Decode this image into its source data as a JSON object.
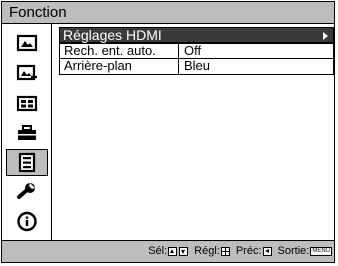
{
  "menu": {
    "title": "Fonction",
    "icons": [
      {
        "name": "picture-icon",
        "active": false
      },
      {
        "name": "advanced-picture-icon",
        "active": false
      },
      {
        "name": "screen-icon",
        "active": false
      },
      {
        "name": "setup-icon",
        "active": false
      },
      {
        "name": "function-icon",
        "active": true
      },
      {
        "name": "installation-icon",
        "active": false
      },
      {
        "name": "information-icon",
        "active": false
      }
    ],
    "rows": [
      {
        "label": "Réglages HDMI",
        "value": "",
        "selected": true
      },
      {
        "label": "Rech. ent. auto.",
        "value": "Off",
        "selected": false
      },
      {
        "label": "Arrière-plan",
        "value": "Bleu",
        "selected": false
      }
    ]
  },
  "status": {
    "select_label": "Sél:",
    "adjust_label": "Régl:",
    "prev_label": "Préc:",
    "exit_label": "Sortie:",
    "menu_key": "MENU"
  }
}
